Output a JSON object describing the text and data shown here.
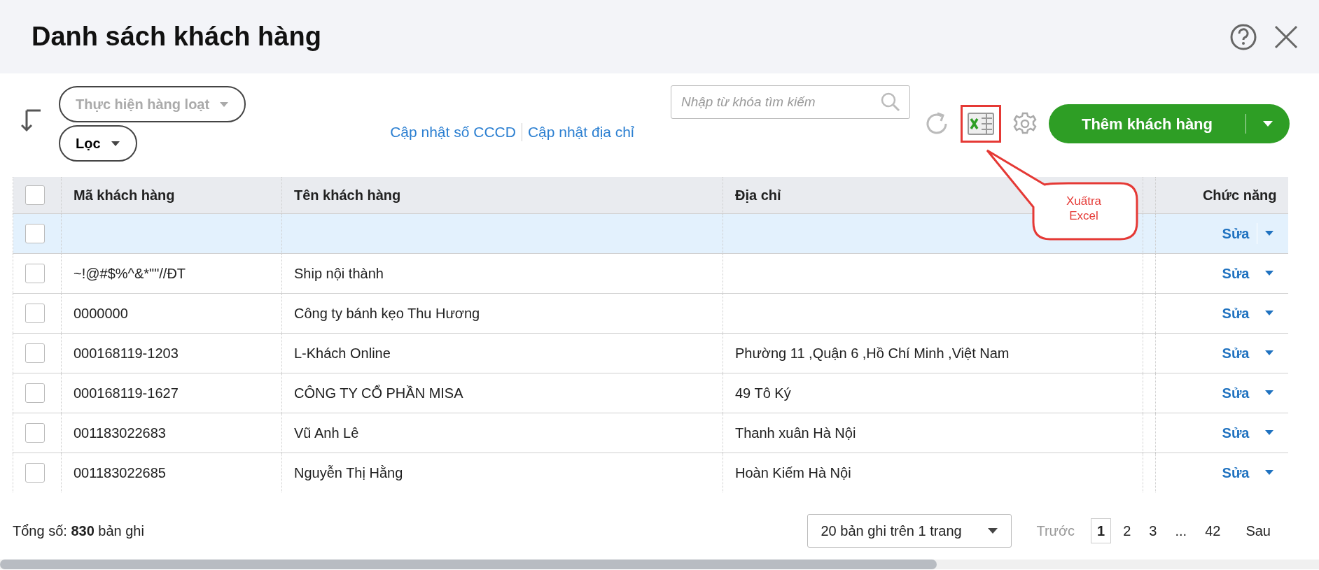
{
  "window": {
    "title": "Danh sách khách hàng"
  },
  "toolbar": {
    "bulk_action": {
      "label": "Thực hiện hàng loạt",
      "disabled": true
    },
    "filter": {
      "label": "Lọc",
      "disabled": false
    },
    "links": [
      "Cập nhật số CCCD",
      "Cập nhật địa chỉ"
    ],
    "search": {
      "placeholder": "Nhập từ khóa tìm kiếm"
    },
    "export_button": {
      "highlighted": true
    },
    "add_button": {
      "label": "Thêm khách hàng"
    }
  },
  "callout": {
    "lines": [
      "Xuấtra",
      "Excel"
    ]
  },
  "table": {
    "header_checkbox": {
      "checked": false
    },
    "columns": [
      {
        "label": "Mã khách hàng"
      },
      {
        "label": "Tên khách hàng"
      },
      {
        "label": "Địa chỉ"
      },
      {
        "label": "Chức năng"
      }
    ],
    "rows": [
      {
        "selected": true,
        "checked": false,
        "action": "Sửa"
      },
      {
        "code": "~!@#$%^&*\"\"//ĐT",
        "name": "Ship nội thành",
        "selected": false,
        "checked": false,
        "action": "Sửa"
      },
      {
        "code": "0000000",
        "name": "Công ty bánh kẹo Thu Hương",
        "selected": false,
        "checked": false,
        "action": "Sửa"
      },
      {
        "code": "000168119-1203",
        "name": "L-Khách Online",
        "address": "Phường 11 ,Quận 6 ,Hồ Chí Minh ,Việt Nam",
        "selected": false,
        "checked": false,
        "action": "Sửa"
      },
      {
        "code": "000168119-1627",
        "name": "CÔNG TY CỔ PHẦN MISA",
        "address": "49 Tô Ký",
        "selected": false,
        "checked": false,
        "action": "Sửa"
      },
      {
        "code": "001183022683",
        "name": "Vũ Anh Lê",
        "address": "Thanh xuân Hà Nội",
        "selected": false,
        "checked": false,
        "action": "Sửa"
      },
      {
        "code": "001183022685",
        "name": "Nguyễn Thị Hằng",
        "address": "Hoàn Kiếm Hà Nội",
        "selected": false,
        "checked": false,
        "action": "Sửa"
      }
    ]
  },
  "footer": {
    "total": "Tổng số: **830** bản ghi",
    "page_size": "20 bản ghi trên 1 trang",
    "prev": {
      "label": "Trước",
      "disabled": true
    },
    "pages": [
      {
        "label": "1",
        "selected": true
      },
      {
        "label": "2",
        "selected": false
      },
      {
        "label": "3",
        "selected": false
      },
      {
        "label": "...",
        "selected": false
      },
      {
        "label": "42",
        "selected": false
      }
    ],
    "next": {
      "label": "Sau",
      "disabled": false
    }
  }
}
